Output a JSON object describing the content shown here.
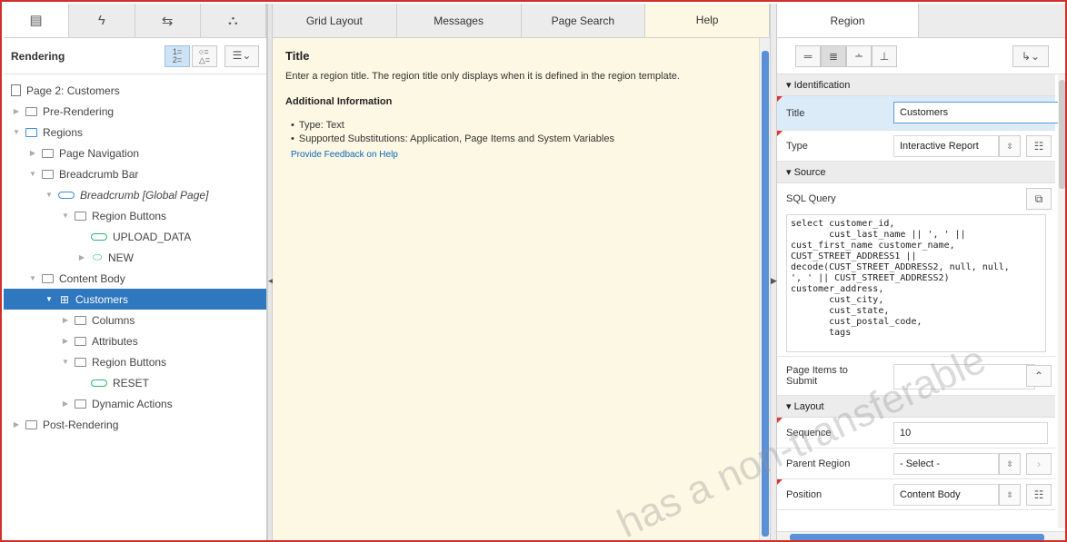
{
  "left": {
    "tabs": [
      "rendering-icon",
      "dynamic-actions-icon",
      "processing-icon",
      "shared-components-icon"
    ],
    "toolbar_title": "Rendering",
    "tree": [
      {
        "label": "Page 2: Customers",
        "level": 0
      },
      {
        "label": "Pre-Rendering",
        "level": 0
      },
      {
        "label": "Regions",
        "level": 0
      },
      {
        "label": "Page Navigation",
        "level": 1
      },
      {
        "label": "Breadcrumb Bar",
        "level": 1
      },
      {
        "label": "Breadcrumb [Global Page]",
        "level": 2
      },
      {
        "label": "Region Buttons",
        "level": 3
      },
      {
        "label": "UPLOAD_DATA",
        "level": 4
      },
      {
        "label": "NEW",
        "level": 4
      },
      {
        "label": "Content Body",
        "level": 1
      },
      {
        "label": "Customers",
        "level": 2
      },
      {
        "label": "Columns",
        "level": 3
      },
      {
        "label": "Attributes",
        "level": 3
      },
      {
        "label": "Region Buttons",
        "level": 3
      },
      {
        "label": "RESET",
        "level": 4
      },
      {
        "label": "Dynamic Actions",
        "level": 3
      },
      {
        "label": "Post-Rendering",
        "level": 0
      }
    ]
  },
  "middle": {
    "tabs": [
      "Grid Layout",
      "Messages",
      "Page Search",
      "Help"
    ],
    "help": {
      "title": "Title",
      "description": "Enter a region title. The region title only displays when it is defined in the region template.",
      "additional_heading": "Additional Information",
      "bullets": [
        "Type: Text",
        "Supported Substitutions: Application, Page Items and System Variables"
      ],
      "feedback_link": "Provide Feedback on Help"
    }
  },
  "right": {
    "tab": "Region",
    "sections": {
      "identification": "▾ Identification",
      "source": "▾ Source",
      "layout": "▾ Layout"
    },
    "title_label": "Title",
    "title_value": "Customers",
    "type_label": "Type",
    "type_value": "Interactive Report",
    "sql_label": "SQL Query",
    "sql_value": "select customer_id,\n       cust_last_name || ', ' ||\ncust_first_name customer_name,\nCUST_STREET_ADDRESS1 ||\ndecode(CUST_STREET_ADDRESS2, null, null,\n', ' || CUST_STREET_ADDRESS2)\ncustomer_address,\n       cust_city,\n       cust_state,\n       cust_postal_code,\n       tags",
    "page_items_label": "Page Items to Submit",
    "sequence_label": "Sequence",
    "sequence_value": "10",
    "parent_region_label": "Parent Region",
    "parent_region_value": "- Select -",
    "position_label": "Position",
    "position_value": "Content Body"
  },
  "watermark": "has a non-transferable"
}
